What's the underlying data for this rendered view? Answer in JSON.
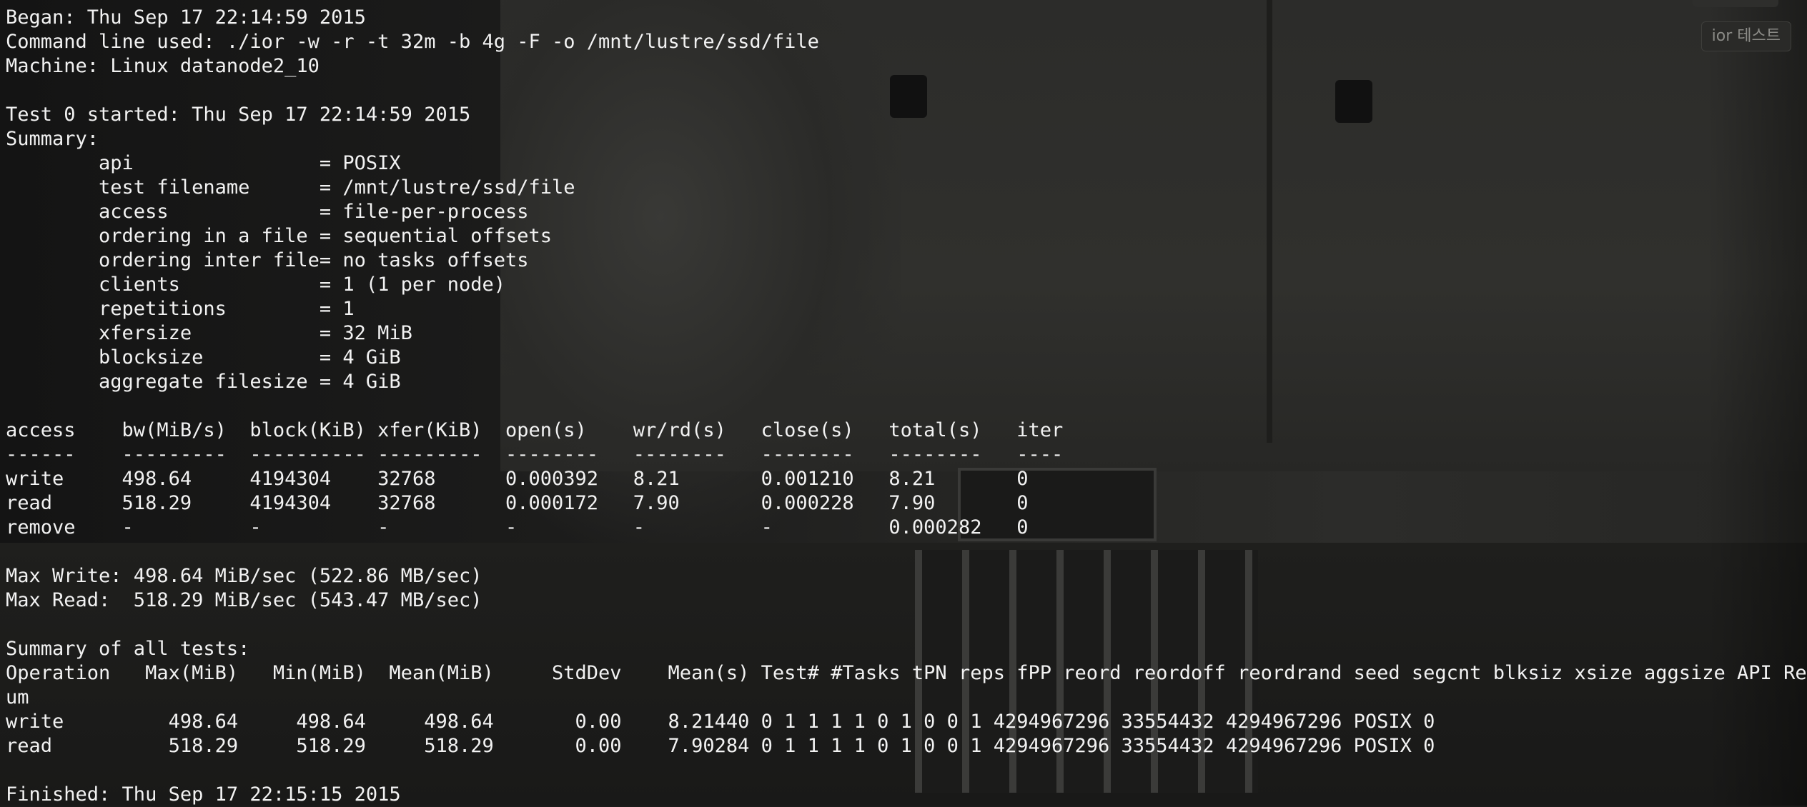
{
  "window_tab": {
    "label": "ior 테스트"
  },
  "terminal": {
    "lines": [
      "Began: Thu Sep 17 22:14:59 2015",
      "Command line used: ./ior -w -r -t 32m -b 4g -F -o /mnt/lustre/ssd/file",
      "Machine: Linux datanode2_10",
      "",
      "Test 0 started: Thu Sep 17 22:14:59 2015",
      "Summary:",
      "        api                = POSIX",
      "        test filename      = /mnt/lustre/ssd/file",
      "        access             = file-per-process",
      "        ordering in a file = sequential offsets",
      "        ordering inter file= no tasks offsets",
      "        clients            = 1 (1 per node)",
      "        repetitions        = 1",
      "        xfersize           = 32 MiB",
      "        blocksize          = 4 GiB",
      "        aggregate filesize = 4 GiB",
      "",
      "access    bw(MiB/s)  block(KiB) xfer(KiB)  open(s)    wr/rd(s)   close(s)   total(s)   iter",
      "------    ---------  ---------- ---------  --------   --------   --------   --------   ----",
      "write     498.64     4194304    32768      0.000392   8.21       0.001210   8.21       0",
      "read      518.29     4194304    32768      0.000172   7.90       0.000228   7.90       0",
      "remove    -          -          -          -          -          -          0.000282   0",
      "",
      "Max Write: 498.64 MiB/sec (522.86 MB/sec)",
      "Max Read:  518.29 MiB/sec (543.47 MB/sec)",
      "",
      "Summary of all tests:",
      "Operation   Max(MiB)   Min(MiB)  Mean(MiB)     StdDev    Mean(s) Test# #Tasks tPN reps fPP reord reordoff reordrand seed segcnt blksiz xsize aggsize API RefN",
      "um",
      "write         498.64     498.64     498.64       0.00    8.21440 0 1 1 1 1 0 1 0 0 1 4294967296 33554432 4294967296 POSIX 0",
      "read          518.29     518.29     518.29       0.00    7.90284 0 1 1 1 1 0 1 0 0 1 4294967296 33554432 4294967296 POSIX 0",
      "",
      "Finished: Thu Sep 17 22:15:15 2015"
    ]
  }
}
